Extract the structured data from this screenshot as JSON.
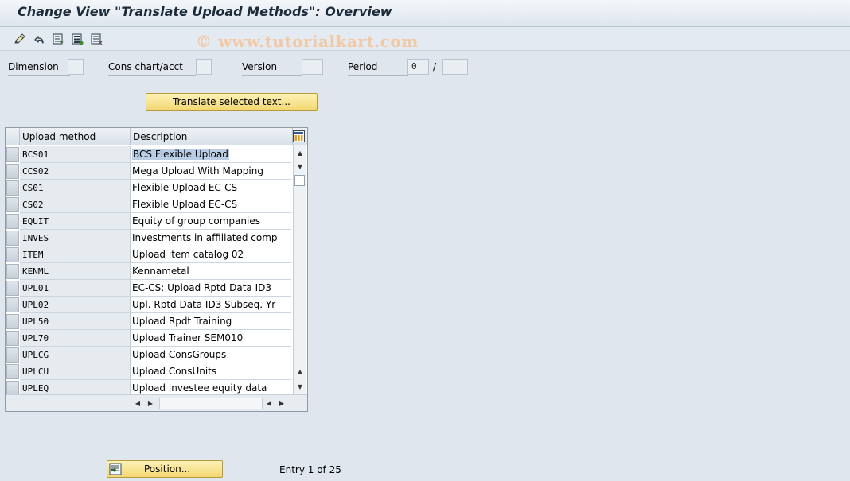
{
  "title": "Change View \"Translate Upload Methods\": Overview",
  "watermark": "© www.tutorialkart.com",
  "toolbar": {
    "icons": [
      "edit-pencil-icon",
      "undo-icon",
      "select-block-icon",
      "select-all-icon",
      "deselect-all-icon"
    ]
  },
  "header_fields": {
    "dimension": {
      "label": "Dimension",
      "value": ""
    },
    "cons_chart": {
      "label": "Cons chart/acct",
      "value": ""
    },
    "version": {
      "label": "Version",
      "value": ""
    },
    "period": {
      "label": "Period",
      "value": "0",
      "separator": "/",
      "year": ""
    }
  },
  "translate_button": "Translate selected text...",
  "table": {
    "columns": [
      "Upload method",
      "Description"
    ],
    "rows": [
      {
        "method": "BCS01",
        "description": "BCS Flexible Upload"
      },
      {
        "method": "CCS02",
        "description": "Mega Upload With Mapping"
      },
      {
        "method": "CS01",
        "description": "Flexible Upload EC-CS"
      },
      {
        "method": "CS02",
        "description": "Flexible Upload EC-CS"
      },
      {
        "method": "EQUIT",
        "description": "Equity of group companies"
      },
      {
        "method": "INVES",
        "description": "Investments in affiliated comp"
      },
      {
        "method": "ITEM",
        "description": "Upload item catalog 02"
      },
      {
        "method": "KENML",
        "description": "Kennametal"
      },
      {
        "method": "UPL01",
        "description": "EC-CS: Upload Rptd Data  ID3"
      },
      {
        "method": "UPL02",
        "description": "Upl. Rptd Data ID3 Subseq. Yr"
      },
      {
        "method": "UPL50",
        "description": "Upload Rpdt Training"
      },
      {
        "method": "UPL70",
        "description": "Upload Trainer SEM010"
      },
      {
        "method": "UPLCG",
        "description": "Upload ConsGroups"
      },
      {
        "method": "UPLCU",
        "description": " Upload ConsUnits"
      },
      {
        "method": "UPLEQ",
        "description": "Upload investee equity data"
      }
    ]
  },
  "position_button": "Position...",
  "entry_info": "Entry 1 of 25",
  "colors": {
    "background": "#dfe6ee",
    "button_yellow": "#f3d873",
    "selection_highlight": "#b9cde5"
  }
}
